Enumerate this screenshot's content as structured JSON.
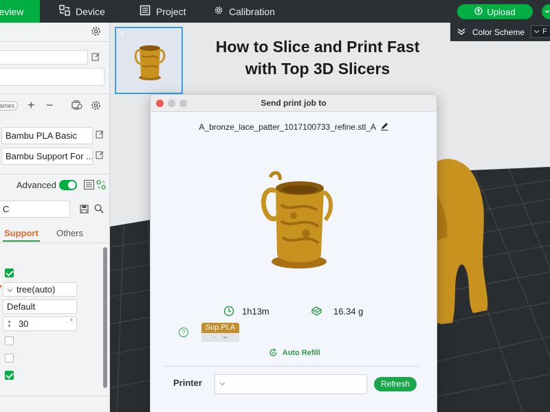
{
  "topbar": {
    "tabs": [
      "review",
      "Device",
      "Project",
      "Calibration"
    ],
    "upload_label": "Upload"
  },
  "headline": {
    "line1": "How to Slice and Print Fast",
    "line2": "with Top 3D Slicers"
  },
  "color_scheme": {
    "label": "Color Scheme",
    "value_fragment": "F"
  },
  "thumbnail": {
    "number": "1"
  },
  "left_panel": {
    "presets_pill": "ames",
    "filaments": [
      "Bambu PLA Basic",
      "Bambu Support For ..."
    ],
    "advanced_label": "Advanced",
    "search_fragment": "C",
    "tabs": [
      "Support",
      "Others"
    ],
    "settings": {
      "support_type": "tree(auto)",
      "style": "Default",
      "threshold_angle": "30",
      "threshold_unit": "°"
    }
  },
  "dialog": {
    "title": "Send print job to",
    "filename": "A_bronze_lace_patter_1017100733_refine.stl_A",
    "time": "1h13m",
    "weight": "16.34 g",
    "help_glyph": "?",
    "filament_badge": "Sup.PLA",
    "filament_slot": "-",
    "auto_refill": "Auto Refill",
    "printer_label": "Printer",
    "refresh_label": "Refresh"
  },
  "colors": {
    "accent_green": "#00ae42",
    "topbar": "#2b3035",
    "model_gold": "#c8921f",
    "dialog_bg": "#f3f7fd"
  }
}
